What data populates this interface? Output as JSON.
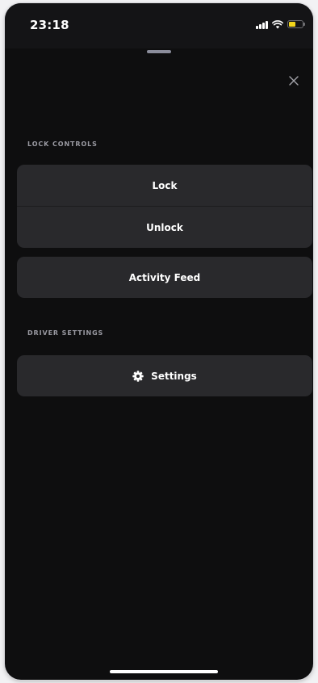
{
  "status_bar": {
    "time": "23:18",
    "icons": [
      "cellular-signal-icon",
      "wifi-icon",
      "battery-icon"
    ],
    "battery_color": "#f2d51b"
  },
  "sheet": {
    "close_icon": "close-icon"
  },
  "lock_controls": {
    "heading": "LOCK CONTROLS",
    "items": [
      {
        "label": "Lock"
      },
      {
        "label": "Unlock"
      }
    ]
  },
  "activity": {
    "label": "Activity Feed"
  },
  "driver_settings": {
    "heading": "DRIVER SETTINGS",
    "settings_label": "Settings",
    "settings_icon": "gear-icon"
  },
  "colors": {
    "background": "#0e0e0f",
    "card": "#29292c",
    "text": "#ffffff",
    "section_label": "#9a9aa2"
  }
}
